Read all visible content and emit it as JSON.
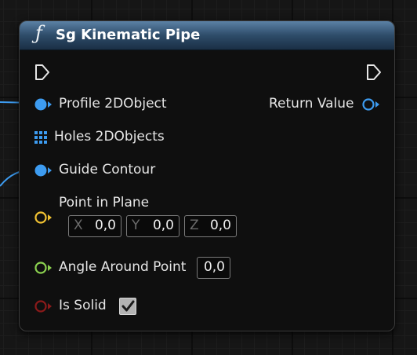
{
  "node": {
    "title": "Sg Kinematic Pipe",
    "function_icon": "ƒ"
  },
  "colors": {
    "header": "#2e4c69",
    "object_pin": "#3d9cf1",
    "vector_pin": "#f1c232",
    "float_pin": "#8bd14f",
    "bool_pin": "#8b1a1a",
    "wire": "#3d9cf1"
  },
  "pins": {
    "exec_in_icon": "exec-triangle-icon",
    "exec_out_icon": "exec-triangle-icon",
    "profile": {
      "label": "Profile 2DObject",
      "icon": "object-pin-icon"
    },
    "holes": {
      "label": "Holes 2DObjects",
      "icon": "array-grid-icon"
    },
    "guide": {
      "label": "Guide Contour",
      "icon": "object-pin-icon"
    },
    "point": {
      "label": "Point in Plane",
      "icon": "vector-pin-icon",
      "x_label": "X",
      "x_value": "0,0",
      "y_label": "Y",
      "y_value": "0,0",
      "z_label": "Z",
      "z_value": "0,0"
    },
    "angle": {
      "label": "Angle Around Point",
      "value": "0,0",
      "icon": "float-pin-icon"
    },
    "solid": {
      "label": "Is Solid",
      "checked": true,
      "icon": "bool-pin-icon"
    },
    "return_value": {
      "label": "Return Value",
      "icon": "object-pin-icon"
    }
  }
}
